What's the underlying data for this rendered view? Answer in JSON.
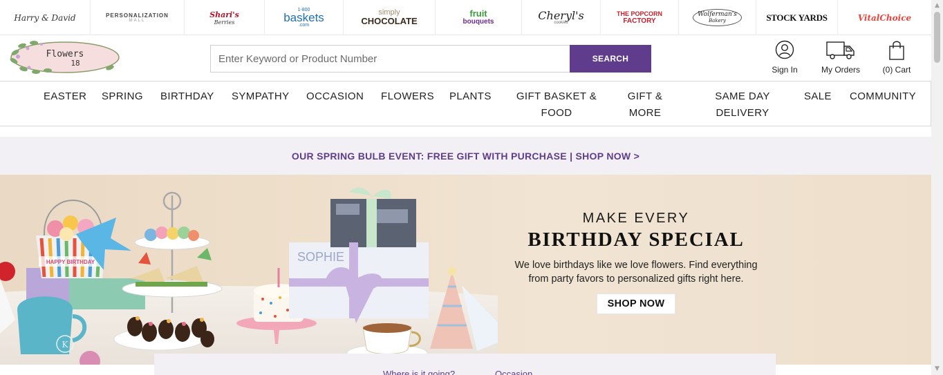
{
  "brands": [
    {
      "name": "Harry & David",
      "color": "#333333"
    },
    {
      "name": "PERSONALIZATION",
      "sub": "MALL",
      "color": "#444444"
    },
    {
      "name": "Shari's",
      "sub": "Berries",
      "color": "#b3122b"
    },
    {
      "name": "baskets",
      "pre": "1-800",
      "sub": ".com",
      "color": "#1d6fb8"
    },
    {
      "name": "simply",
      "sub": "CHOCOLATE",
      "color": "#3a2a1e"
    },
    {
      "name": "fruit",
      "sub": "bouquets",
      "color": "#6b2a8e"
    },
    {
      "name": "Cheryl's",
      "sub": "cookies",
      "color": "#222222"
    },
    {
      "name": "THE POPCORN",
      "sub": "FACTORY",
      "color": "#c41e2a"
    },
    {
      "name": "Wolferman's",
      "sub": "Bakery",
      "color": "#222222"
    },
    {
      "name": "STOCK YARDS",
      "color": "#111111"
    },
    {
      "name": "VitalChoice",
      "color": "#e8433a"
    }
  ],
  "logo": {
    "line1": "Flowers",
    "line2": "18"
  },
  "search": {
    "placeholder": "Enter Keyword or Product Number",
    "button": "SEARCH"
  },
  "header_actions": {
    "sign_in": "Sign In",
    "orders": "My Orders",
    "cart": "(0) Cart"
  },
  "nav": [
    {
      "label": "EASTER"
    },
    {
      "label": "SPRING"
    },
    {
      "label": "BIRTHDAY"
    },
    {
      "label": "SYMPATHY"
    },
    {
      "label": "OCCASION"
    },
    {
      "label": "FLOWERS"
    },
    {
      "label": "PLANTS"
    },
    {
      "label": "GIFT BASKET &",
      "label2": "FOOD"
    },
    {
      "label": "GIFT &",
      "label2": "MORE"
    },
    {
      "label": "SAME DAY",
      "label2": "DELIVERY"
    },
    {
      "label": "SALE"
    },
    {
      "label": "COMMUNITY"
    }
  ],
  "promo": {
    "text": "OUR SPRING BULB EVENT: FREE GIFT WITH PURCHASE | SHOP NOW >"
  },
  "hero": {
    "eyebrow": "MAKE EVERY",
    "headline": "BIRTHDAY SPECIAL",
    "subtext_line1": "We love birthdays like we love flowers. Find everything",
    "subtext_line2": "from party favors to personalized gifts right here.",
    "cta": "SHOP NOW",
    "gift_name": "SOPHIE",
    "bucket_text": "HAPPY BIRTHDAY"
  },
  "finder": {
    "where": "Where is it going?",
    "occasion": "Occasion"
  },
  "colors": {
    "accent": "#5f3c8c",
    "promo_bg": "#f3f0f5",
    "hero_bg": "#efe1ce"
  }
}
